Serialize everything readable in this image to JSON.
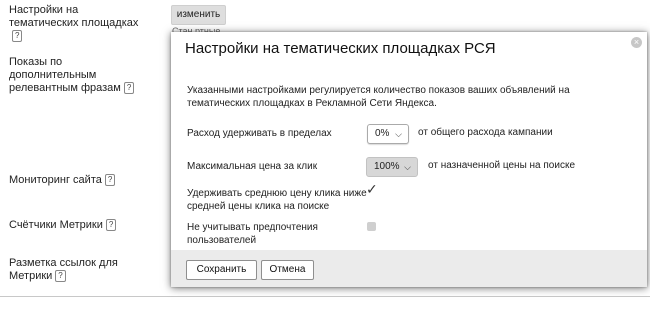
{
  "background": {
    "settings": [
      {
        "label": "Настройки на тематических площадках",
        "help": "?"
      },
      {
        "label": "Показы по дополнительным релевантным фразам",
        "help": "?"
      },
      {
        "label": "Мониторинг сайта",
        "help": "?"
      },
      {
        "label": "Счётчики Метрики",
        "help": "?"
      },
      {
        "label": "Разметка ссылок для Метрики",
        "help": "?"
      }
    ],
    "change_button": "изменить",
    "partial_text": "Стан  ртные"
  },
  "dialog": {
    "title": "Настройки на тематических площадках РСЯ",
    "close_icon": "×",
    "description": "Указанными настройками регулируется количество показов ваших объявлений на тематических площадках в Рекламной Сети Яндекса.",
    "spend": {
      "label": "Расход удерживать в пределах",
      "value": "0%",
      "suffix": "от общего расхода кампании"
    },
    "max_price": {
      "label": "Максимальная цена за клик",
      "value": "100%",
      "suffix": "от назначенной цены на поиске"
    },
    "keep_avg": {
      "label": "Удерживать среднюю цену клика ниже средней цены клика на поиске",
      "checked": true
    },
    "ignore_prefs": {
      "label": "Не учитывать предпочтения пользователей",
      "checked": false
    },
    "save_label": "Сохранить",
    "cancel_label": "Отмена"
  }
}
